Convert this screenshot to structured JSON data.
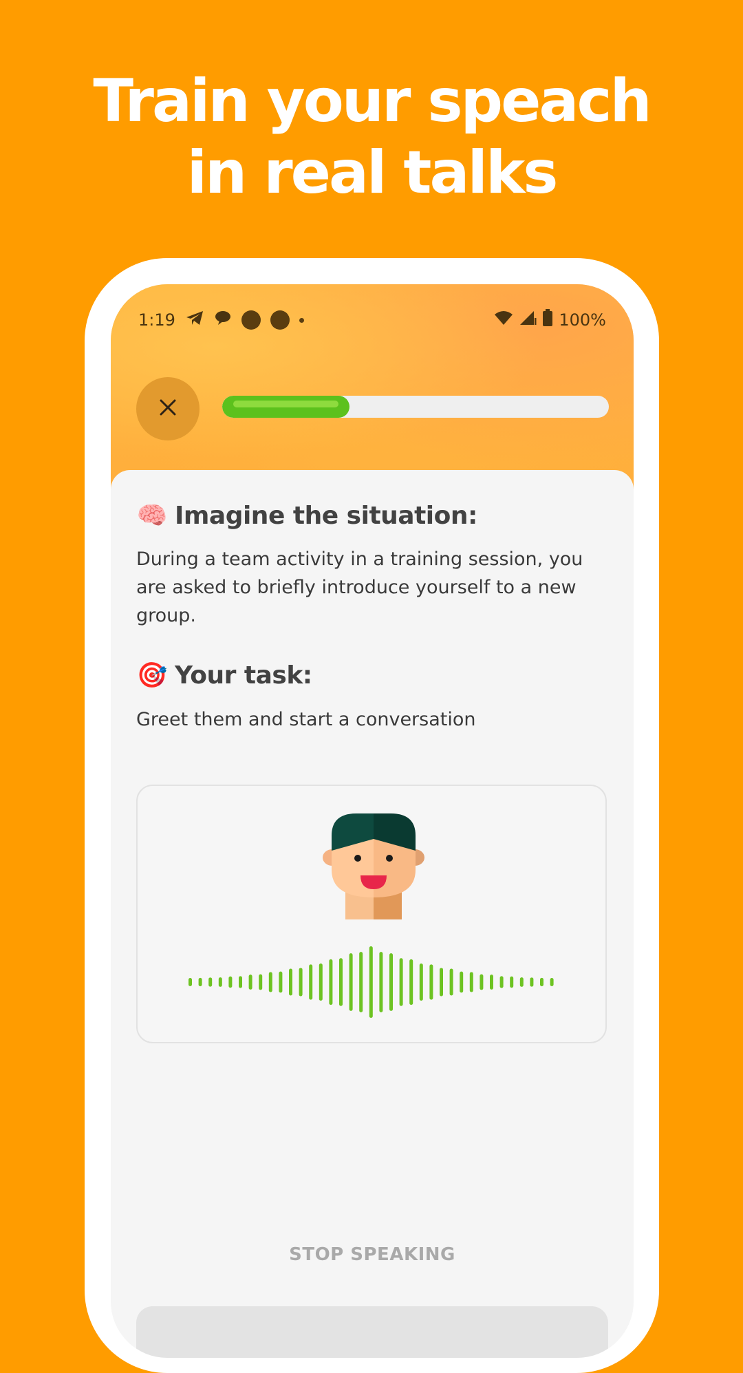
{
  "headline": {
    "line1": "Train your speach",
    "line2": "in real talks"
  },
  "status_bar": {
    "time": "1:19",
    "battery": "100%",
    "icons": [
      "telegram-icon",
      "message-icon",
      "notification-dot-icon",
      "notification-dot-icon",
      "more-dot-icon",
      "wifi-icon",
      "signal-icon",
      "battery-icon"
    ]
  },
  "lesson": {
    "close_icon": "close-icon",
    "progress": 0.33,
    "situation_emoji": "🧠",
    "situation_title": "Imagine the situation:",
    "situation_text": "During a team activity in a training session, you are asked to briefly introduce yourself to a new group.",
    "task_emoji": "🎯",
    "task_title": "Your task:",
    "task_text": "Greet them and start a conversation",
    "stop_label": "STOP SPEAKING"
  },
  "colors": {
    "background": "#FF9C00",
    "progress_fill": "#5CC11D",
    "waveform": "#6DC322",
    "text": "#424242"
  }
}
